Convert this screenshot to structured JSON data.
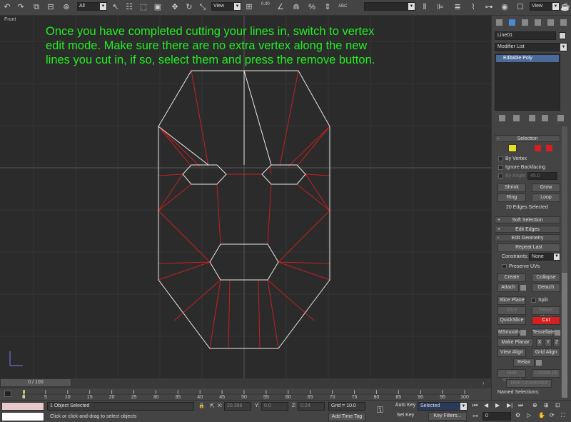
{
  "toolbar": {
    "filter_value": "All",
    "view_value": "View",
    "snap_value": "0.00",
    "snap_label": "ABC"
  },
  "viewport": {
    "label": "Front",
    "caption_lines": [
      "Once you have completed cutting your lines in, switch to vertex",
      "edit mode.  Make sure there are no extra vertex along the new",
      "lines you cut in, if so, select them and press the remove button."
    ]
  },
  "command_panel": {
    "object_name": "Line01",
    "modifier_list": "Modifier List",
    "stack_item": "Editable Poly",
    "selection_title": "Selection",
    "by_vertex": "By Vertex",
    "ignore_backfacing": "Ignore Backfacing",
    "by_angle": "By Angle:",
    "angle_value": "45.0",
    "shrink": "Shrink",
    "grow": "Grow",
    "ring": "Ring",
    "loop": "Loop",
    "selection_status": "20 Edges Selected",
    "soft_selection": "Soft Selection",
    "edit_edges": "Edit Edges",
    "edit_geometry": "Edit Geometry",
    "repeat_last": "Repeat Last",
    "constraints_label": "Constraints:",
    "constraints_value": "None",
    "preserve_uvs": "Preserve UVs",
    "create": "Create",
    "collapse": "Collapse",
    "attach": "Attach",
    "detach": "Detach",
    "slice_plane": "Slice Plane",
    "split": "Split",
    "slice": "Slice",
    "reset_plane": "Reset Plane",
    "quickslice": "QuickSlice",
    "cut": "Cut",
    "msmooth": "MSmooth",
    "tessellate": "Tessellate",
    "make_planar": "Make Planar",
    "x": "X",
    "y": "Y",
    "z": "Z",
    "view_align": "View Align",
    "grid_align": "Grid Align",
    "relax": "Relax",
    "hide_selected": "Hide Selected",
    "unhide_all": "Unhide All",
    "hide_unselected": "Hide Unselected",
    "named_selections": "Named Selections:"
  },
  "timeline": {
    "slider": "0 / 100",
    "ticks": [
      "0",
      "5",
      "10",
      "15",
      "20",
      "25",
      "30",
      "35",
      "40",
      "45",
      "50",
      "55",
      "60",
      "65",
      "70",
      "75",
      "80",
      "85",
      "90",
      "95",
      "100"
    ]
  },
  "status": {
    "selected": "1 Object Selected",
    "prompt": "Click or click-and-drag to select objects",
    "x_label": "X:",
    "x_value": "20.358",
    "y_label": "Y:",
    "y_value": "0.0",
    "z_label": "Z:",
    "z_value": "0.24",
    "grid": "Grid = 10.0",
    "add_time_tag": "Add Time Tag",
    "auto_key": "Auto Key",
    "selected_value": "Selected",
    "set_key": "Set Key",
    "key_filters": "Key Filters...",
    "frame_value": "0"
  },
  "colors": {
    "caption": "#22ee22",
    "white_edge": "#e8e8e8",
    "red_edge": "#c42020",
    "cut_button": "#d42020",
    "stack_highlight": "#4a6a9a"
  }
}
